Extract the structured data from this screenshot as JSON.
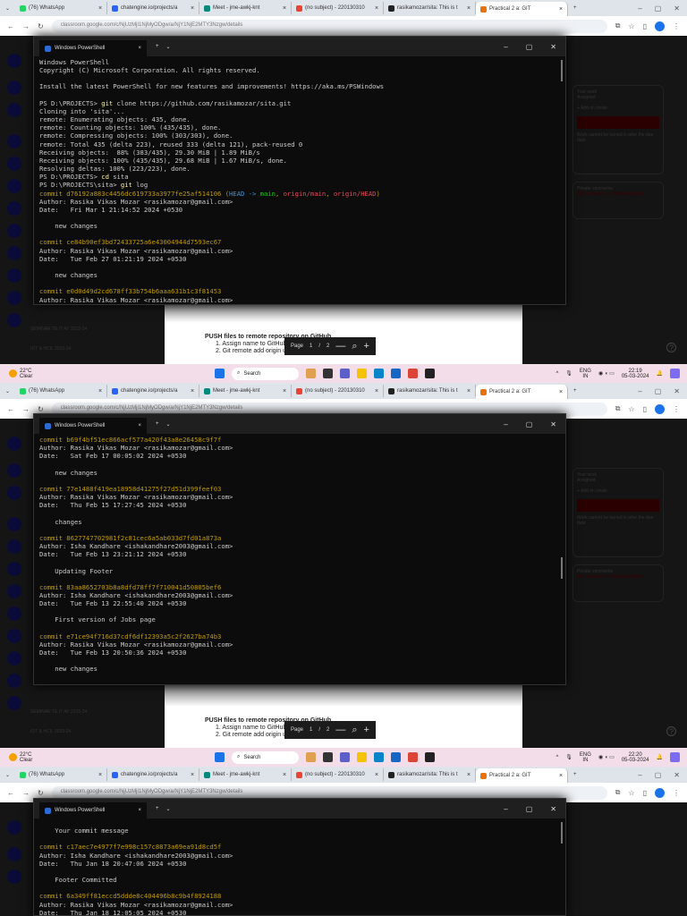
{
  "browser": {
    "tabs": [
      {
        "label": "(76) WhatsApp",
        "color": "#25d366"
      },
      {
        "label": "chatengine.io/projects/a",
        "color": "#2962ff"
      },
      {
        "label": "Meet - jme-awkj-knt",
        "color": "#00897b"
      },
      {
        "label": "(no subject) - 220130310",
        "color": "#ea4335"
      },
      {
        "label": "rasikamozar/sita: This is t",
        "color": "#222222"
      },
      {
        "label": "Practical 2 a: GIT",
        "color": "#e8710a"
      }
    ],
    "url": "classroom.google.com/c/NjUzMjI1NjMyODgw/a/NjY1NjE2MTY3Nzgw/details"
  },
  "terminal": {
    "title": "Windows PowerShell",
    "panels": [
      [
        "Windows PowerShell",
        "Copyright (C) Microsoft Corporation. All rights reserved.",
        "",
        "Install the latest PowerShell for new features and improvements! https://aka.ms/PSWindows",
        "",
        [
          [
            "PS D:\\PROJECTS> ",
            "n"
          ],
          [
            "git",
            "k"
          ],
          [
            " clone https://github.com/rasikamozar/sita.git",
            "n"
          ]
        ],
        "Cloning into 'sita'...",
        "remote: Enumerating objects: 435, done.",
        "remote: Counting objects: 100% (435/435), done.",
        "remote: Compressing objects: 100% (303/303), done.",
        "remote: Total 435 (delta 223), reused 333 (delta 121), pack-reused 0",
        "Receiving objects:  88% (383/435), 29.30 MiB | 1.89 MiB/s",
        "Receiving objects: 100% (435/435), 29.68 MiB | 1.67 MiB/s, done.",
        "Resolving deltas: 100% (223/223), done.",
        [
          [
            "PS D:\\PROJECTS> ",
            "n"
          ],
          [
            "cd",
            "k"
          ],
          [
            " sita",
            "n"
          ]
        ],
        [
          [
            "PS D:\\PROJECTS\\sita> ",
            "n"
          ],
          [
            "git",
            "k"
          ],
          [
            " log",
            "n"
          ]
        ],
        [
          [
            "commit d76192a883c4456dc619733a3977fe25af514106 (",
            "c"
          ],
          [
            "HEAD -> ",
            "h"
          ],
          [
            "main",
            "g"
          ],
          [
            ", ",
            "c"
          ],
          [
            "origin/main",
            "r"
          ],
          [
            ", ",
            "c"
          ],
          [
            "origin/HEAD",
            "r"
          ],
          [
            ")",
            "c"
          ]
        ],
        "Author: Rasika Vikas Mozar <rasikamozar@gmail.com>",
        "Date:   Fri Mar 1 21:14:52 2024 +0530",
        "",
        "    new changes",
        "",
        [
          [
            "commit ce84b90ef3bd72433725a6e43004944d7593ec67",
            "c"
          ]
        ],
        "Author: Rasika Vikas Mozar <rasikamozar@gmail.com>",
        "Date:   Tue Feb 27 01:21:19 2024 +0530",
        "",
        "    new changes",
        "",
        [
          [
            "commit e0d0d49d2cd678ff33b754b6aaa631b1c3f81453",
            "c"
          ]
        ],
        "Author: Rasika Vikas Mozar <rasikamozar@gmail.com>"
      ],
      [
        [
          [
            "commit b69f4bf51ec866acf577a420f43a8e26458c9f7f",
            "c"
          ]
        ],
        "Author: Rasika Vikas Mozar <rasikamozar@gmail.com>",
        "Date:   Sat Feb 17 00:05:02 2024 +0530",
        "",
        "    new changes",
        "",
        [
          [
            "commit 77e1488f419ea18958d41275f27d51d399feef03",
            "c"
          ]
        ],
        "Author: Rasika Vikas Mozar <rasikamozar@gmail.com>",
        "Date:   Thu Feb 15 17:27:45 2024 +0530",
        "",
        "    changes",
        "",
        [
          [
            "commit 8627747702981f2c81cec6a5ab033d7fd01a873a",
            "c"
          ]
        ],
        "Author: Isha Kandhare <ishakandhare2003@gmail.com>",
        "Date:   Tue Feb 13 23:21:12 2024 +0530",
        "",
        "    Updating Footer",
        "",
        [
          [
            "commit 83aa8652703b8a8dfd78ff7f710041d50805bef6",
            "c"
          ]
        ],
        "Author: Isha Kandhare <ishakandhare2003@gmail.com>",
        "Date:   Tue Feb 13 22:55:40 2024 +0530",
        "",
        "    First version of Jobs page",
        "",
        [
          [
            "commit e71ce94f716d37cdf6df12393a5c2f2627ba74b3",
            "c"
          ]
        ],
        "Author: Rasika Vikas Mozar <rasikamozar@gmail.com>",
        "Date:   Tue Feb 13 20:50:36 2024 +0530",
        "",
        "    new changes"
      ],
      [
        "",
        "    Your commit message",
        "",
        [
          [
            "commit c17aec7e4977f7e998c157c8873a69ea91d8cd5f",
            "c"
          ]
        ],
        "Author: Isha Kandhare <ishakandhare2003@gmail.com>",
        "Date:   Thu Jan 18 20:47:06 2024 +0530",
        "",
        "    Footer Committed",
        "",
        [
          [
            "commit 6a349ff81eccd5ddde8c404496b8c9b4f8924188",
            "c"
          ]
        ],
        "Author: Rasika Vikas Mozar <rasikamozar@gmail.com>",
        "Date:   Thu Jan 18 12:05:05 2024 +0530"
      ]
    ]
  },
  "colors": {
    "n": "#cccccc",
    "k": "#f9f1a5",
    "c": "#c19c00",
    "h": "#3a96dd",
    "g": "#16c60c",
    "r": "#e74856"
  },
  "classroom": {
    "your_work": "Your work",
    "assigned": "Assigned",
    "add_create": "+ Add or create",
    "late_note": "Work cannot be turned in after the due date",
    "private_comments": "Private comments",
    "add_comment": "Add comment to Shubhangi Ghle",
    "classes": [
      "SEMINAR TE IT AY 2023-24",
      "IOT & HCIL 2023-24"
    ]
  },
  "document": {
    "heading": "PUSH files to remote repository on GitHub",
    "items": [
      "1.   Assign name to GitHub repository",
      "2.   Git remote add origin url        //origin is name of url"
    ]
  },
  "pdf": {
    "page_label": "Page",
    "current": "1",
    "sep": "/",
    "total": "2",
    "zoom_out": "—",
    "zoom_in": "+"
  },
  "taskbar": {
    "temperature": "22°C",
    "condition": "Clear",
    "search": "Search",
    "lang1": "ENG",
    "lang2": "IN",
    "shots": [
      {
        "time": "22:19",
        "date": "05-03-2024"
      },
      {
        "time": "22:20",
        "date": "05-03-2024"
      }
    ]
  }
}
